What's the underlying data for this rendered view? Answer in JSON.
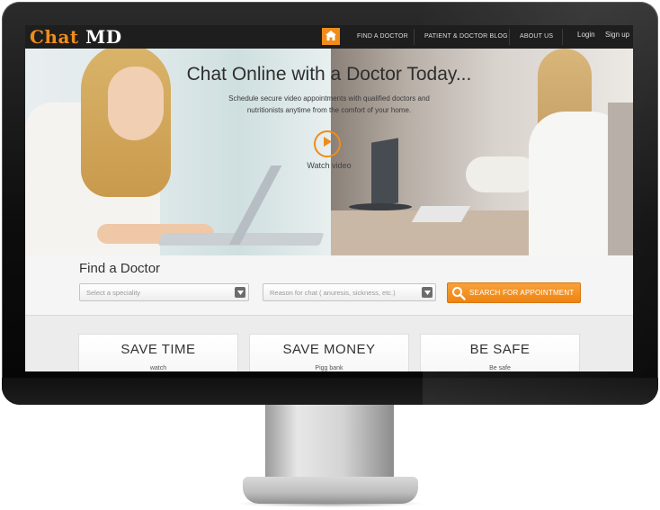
{
  "brand": {
    "name_part1": "Chat",
    "name_part2": "MD",
    "accent_color": "#f08c1a"
  },
  "nav": {
    "home_icon": "home-icon",
    "items": [
      "FIND A DOCTOR",
      "PATIENT & DOCTOR BLOG",
      "ABOUT US"
    ],
    "login": "Login",
    "signup": "Sign up"
  },
  "hero": {
    "title": "Chat Online with a Doctor Today...",
    "subtitle_line1": "Schedule secure video appointments with qualified doctors and",
    "subtitle_line2": "nutritionists anytime from the comfort of your home.",
    "play_icon": "play-icon",
    "watch_label": "Watch video"
  },
  "find": {
    "title": "Find a Doctor",
    "speciality_placeholder": "Select a speciality",
    "reason_placeholder": "Reason for chat ( anuresis, sickness, etc.)",
    "search_label": "SEARCH FOR APPOINTMENT",
    "search_icon": "search-icon"
  },
  "features": [
    {
      "title": "SAVE TIME",
      "subtitle": "watch"
    },
    {
      "title": "SAVE MONEY",
      "subtitle": "Pigg bank"
    },
    {
      "title": "BE SAFE",
      "subtitle": "Be safe"
    }
  ]
}
